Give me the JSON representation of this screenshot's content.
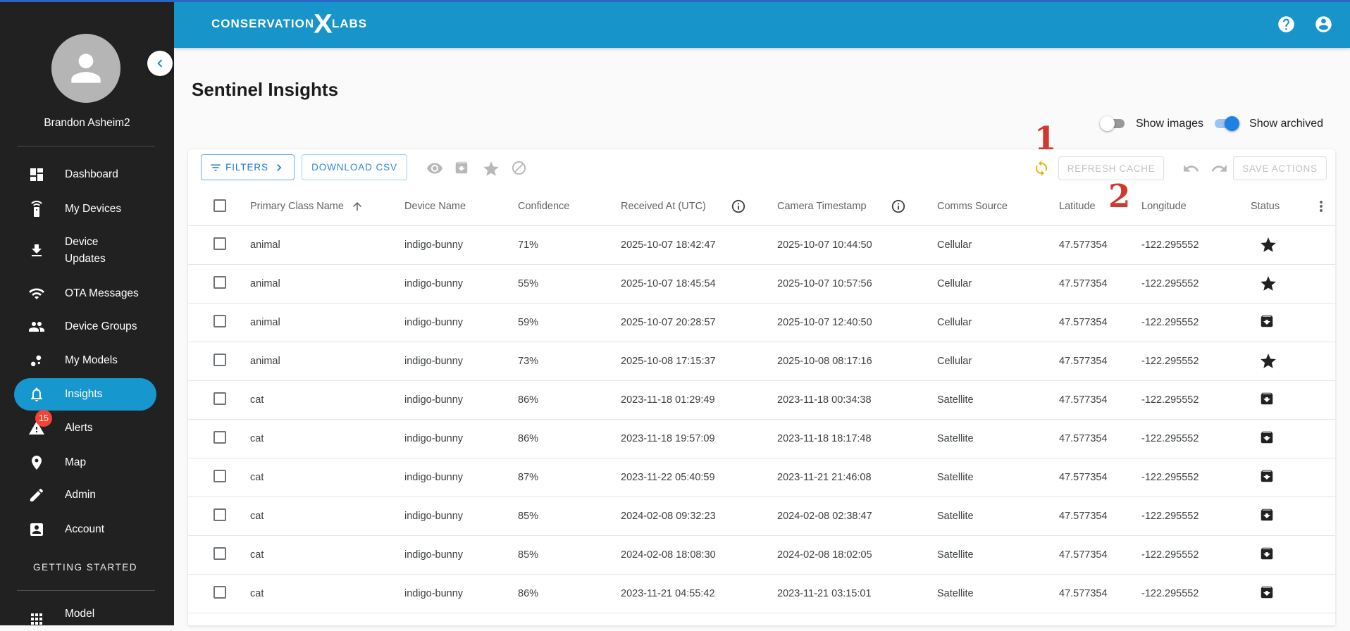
{
  "appbar": {
    "logo_part1": "CONSERVATION",
    "logo_x": "X",
    "logo_part2": "LABS",
    "bg_color": "#1795ca"
  },
  "sidebar": {
    "user_name": "Brandon Asheim2",
    "items": [
      {
        "label": "Dashboard",
        "icon": "dashboard-icon",
        "active": false
      },
      {
        "label": "My Devices",
        "icon": "remote-device-icon",
        "active": false
      },
      {
        "label": "Device Updates",
        "icon": "download-icon",
        "active": false
      },
      {
        "label": "OTA Messages",
        "icon": "wifi-icon",
        "active": false
      },
      {
        "label": "Device Groups",
        "icon": "people-icon",
        "active": false
      },
      {
        "label": "My Models",
        "icon": "bubble-chart-icon",
        "active": false
      },
      {
        "label": "Insights",
        "icon": "bell-icon",
        "active": true
      },
      {
        "label": "Alerts",
        "icon": "warning-icon",
        "active": false,
        "badge": "15"
      },
      {
        "label": "Map",
        "icon": "map-pin-icon",
        "active": false
      },
      {
        "label": "Admin",
        "icon": "pencil-icon",
        "active": false
      },
      {
        "label": "Account",
        "icon": "account-box-icon",
        "active": false
      }
    ],
    "section_label": "GETTING STARTED",
    "bottom_items": [
      {
        "label": "Model",
        "icon": "apps-grid-icon"
      }
    ],
    "alerts_badge_color": "#f44336",
    "active_item_color": "#1697ce"
  },
  "page": {
    "title": "Sentinel Insights"
  },
  "controls": {
    "show_images_label": "Show images",
    "show_images_on": false,
    "show_archived_label": "Show archived",
    "show_archived_on": true,
    "toggle_on_color": "#1e82e4"
  },
  "annotations": [
    {
      "text": "1"
    },
    {
      "text": "2"
    }
  ],
  "annotation_color": "#d0392e",
  "toolbar": {
    "filters_label": "FILTERS",
    "download_csv_label": "DOWNLOAD CSV",
    "bulk_icons": [
      "eye-icon",
      "archive-icon",
      "star-icon",
      "block-icon"
    ],
    "refresh_cache_label": "REFRESH CACHE",
    "save_actions_label": "SAVE ACTIONS",
    "sync_icon_color": "#e4b509"
  },
  "table": {
    "columns": [
      {
        "label": "Primary Class Name",
        "sorted": "asc"
      },
      {
        "label": "Device Name"
      },
      {
        "label": "Confidence"
      },
      {
        "label": "Received At (UTC)",
        "info": true
      },
      {
        "label": "Camera Timestamp",
        "info": true
      },
      {
        "label": "Comms Source"
      },
      {
        "label": "Latitude"
      },
      {
        "label": "Longitude"
      },
      {
        "label": "Status"
      }
    ],
    "rows": [
      {
        "primary_class_name": "animal",
        "device_name": "indigo-bunny",
        "confidence": "71%",
        "received_at": "2025-10-07 18:42:47",
        "camera_timestamp": "2025-10-07 10:44:50",
        "comms_source": "Cellular",
        "latitude": "47.577354",
        "longitude": "-122.295552",
        "status_icon": "star-icon"
      },
      {
        "primary_class_name": "animal",
        "device_name": "indigo-bunny",
        "confidence": "55%",
        "received_at": "2025-10-07 18:45:54",
        "camera_timestamp": "2025-10-07 10:57:56",
        "comms_source": "Cellular",
        "latitude": "47.577354",
        "longitude": "-122.295552",
        "status_icon": "star-icon"
      },
      {
        "primary_class_name": "animal",
        "device_name": "indigo-bunny",
        "confidence": "59%",
        "received_at": "2025-10-07 20:28:57",
        "camera_timestamp": "2025-10-07 12:40:50",
        "comms_source": "Cellular",
        "latitude": "47.577354",
        "longitude": "-122.295552",
        "status_icon": "archive-icon"
      },
      {
        "primary_class_name": "animal",
        "device_name": "indigo-bunny",
        "confidence": "73%",
        "received_at": "2025-10-08 17:15:37",
        "camera_timestamp": "2025-10-08 08:17:16",
        "comms_source": "Cellular",
        "latitude": "47.577354",
        "longitude": "-122.295552",
        "status_icon": "star-icon"
      },
      {
        "primary_class_name": "cat",
        "device_name": "indigo-bunny",
        "confidence": "86%",
        "received_at": "2023-11-18 01:29:49",
        "camera_timestamp": "2023-11-18 00:34:38",
        "comms_source": "Satellite",
        "latitude": "47.577354",
        "longitude": "-122.295552",
        "status_icon": "archive-icon"
      },
      {
        "primary_class_name": "cat",
        "device_name": "indigo-bunny",
        "confidence": "86%",
        "received_at": "2023-11-18 19:57:09",
        "camera_timestamp": "2023-11-18 18:17:48",
        "comms_source": "Satellite",
        "latitude": "47.577354",
        "longitude": "-122.295552",
        "status_icon": "archive-icon"
      },
      {
        "primary_class_name": "cat",
        "device_name": "indigo-bunny",
        "confidence": "87%",
        "received_at": "2023-11-22 05:40:59",
        "camera_timestamp": "2023-11-21 21:46:08",
        "comms_source": "Satellite",
        "latitude": "47.577354",
        "longitude": "-122.295552",
        "status_icon": "archive-icon"
      },
      {
        "primary_class_name": "cat",
        "device_name": "indigo-bunny",
        "confidence": "85%",
        "received_at": "2024-02-08 09:32:23",
        "camera_timestamp": "2024-02-08 02:38:47",
        "comms_source": "Satellite",
        "latitude": "47.577354",
        "longitude": "-122.295552",
        "status_icon": "archive-icon"
      },
      {
        "primary_class_name": "cat",
        "device_name": "indigo-bunny",
        "confidence": "85%",
        "received_at": "2024-02-08 18:08:30",
        "camera_timestamp": "2024-02-08 18:02:05",
        "comms_source": "Satellite",
        "latitude": "47.577354",
        "longitude": "-122.295552",
        "status_icon": "archive-icon"
      },
      {
        "primary_class_name": "cat",
        "device_name": "indigo-bunny",
        "confidence": "86%",
        "received_at": "2023-11-21 04:55:42",
        "camera_timestamp": "2023-11-21 03:15:01",
        "comms_source": "Satellite",
        "latitude": "47.577354",
        "longitude": "-122.295552",
        "status_icon": "archive-icon"
      }
    ]
  }
}
